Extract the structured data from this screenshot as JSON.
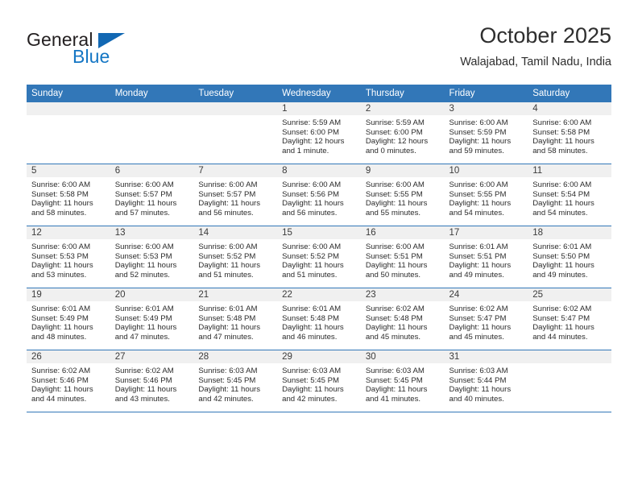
{
  "brand": {
    "name_top": "General",
    "name_bottom": "Blue",
    "triangle_icon": "triangle-icon",
    "accent_color": "#1476c4",
    "triangle_color": "#1268b3"
  },
  "header": {
    "title": "October 2025",
    "subtitle": "Walajabad, Tamil Nadu, India"
  },
  "calendar": {
    "header_bg": "#3277b8",
    "header_text_color": "#ffffff",
    "daynum_bg": "#f0f0f0",
    "row_separator_color": "#3277b8",
    "weekdays": [
      "Sunday",
      "Monday",
      "Tuesday",
      "Wednesday",
      "Thursday",
      "Friday",
      "Saturday"
    ],
    "weeks": [
      [
        {
          "day": "",
          "empty": true
        },
        {
          "day": "",
          "empty": true
        },
        {
          "day": "",
          "empty": true
        },
        {
          "day": "1",
          "sunrise": "Sunrise: 5:59 AM",
          "sunset": "Sunset: 6:00 PM",
          "daylight": "Daylight: 12 hours and 1 minute."
        },
        {
          "day": "2",
          "sunrise": "Sunrise: 5:59 AM",
          "sunset": "Sunset: 6:00 PM",
          "daylight": "Daylight: 12 hours and 0 minutes."
        },
        {
          "day": "3",
          "sunrise": "Sunrise: 6:00 AM",
          "sunset": "Sunset: 5:59 PM",
          "daylight": "Daylight: 11 hours and 59 minutes."
        },
        {
          "day": "4",
          "sunrise": "Sunrise: 6:00 AM",
          "sunset": "Sunset: 5:58 PM",
          "daylight": "Daylight: 11 hours and 58 minutes."
        }
      ],
      [
        {
          "day": "5",
          "sunrise": "Sunrise: 6:00 AM",
          "sunset": "Sunset: 5:58 PM",
          "daylight": "Daylight: 11 hours and 58 minutes."
        },
        {
          "day": "6",
          "sunrise": "Sunrise: 6:00 AM",
          "sunset": "Sunset: 5:57 PM",
          "daylight": "Daylight: 11 hours and 57 minutes."
        },
        {
          "day": "7",
          "sunrise": "Sunrise: 6:00 AM",
          "sunset": "Sunset: 5:57 PM",
          "daylight": "Daylight: 11 hours and 56 minutes."
        },
        {
          "day": "8",
          "sunrise": "Sunrise: 6:00 AM",
          "sunset": "Sunset: 5:56 PM",
          "daylight": "Daylight: 11 hours and 56 minutes."
        },
        {
          "day": "9",
          "sunrise": "Sunrise: 6:00 AM",
          "sunset": "Sunset: 5:55 PM",
          "daylight": "Daylight: 11 hours and 55 minutes."
        },
        {
          "day": "10",
          "sunrise": "Sunrise: 6:00 AM",
          "sunset": "Sunset: 5:55 PM",
          "daylight": "Daylight: 11 hours and 54 minutes."
        },
        {
          "day": "11",
          "sunrise": "Sunrise: 6:00 AM",
          "sunset": "Sunset: 5:54 PM",
          "daylight": "Daylight: 11 hours and 54 minutes."
        }
      ],
      [
        {
          "day": "12",
          "sunrise": "Sunrise: 6:00 AM",
          "sunset": "Sunset: 5:53 PM",
          "daylight": "Daylight: 11 hours and 53 minutes."
        },
        {
          "day": "13",
          "sunrise": "Sunrise: 6:00 AM",
          "sunset": "Sunset: 5:53 PM",
          "daylight": "Daylight: 11 hours and 52 minutes."
        },
        {
          "day": "14",
          "sunrise": "Sunrise: 6:00 AM",
          "sunset": "Sunset: 5:52 PM",
          "daylight": "Daylight: 11 hours and 51 minutes."
        },
        {
          "day": "15",
          "sunrise": "Sunrise: 6:00 AM",
          "sunset": "Sunset: 5:52 PM",
          "daylight": "Daylight: 11 hours and 51 minutes."
        },
        {
          "day": "16",
          "sunrise": "Sunrise: 6:00 AM",
          "sunset": "Sunset: 5:51 PM",
          "daylight": "Daylight: 11 hours and 50 minutes."
        },
        {
          "day": "17",
          "sunrise": "Sunrise: 6:01 AM",
          "sunset": "Sunset: 5:51 PM",
          "daylight": "Daylight: 11 hours and 49 minutes."
        },
        {
          "day": "18",
          "sunrise": "Sunrise: 6:01 AM",
          "sunset": "Sunset: 5:50 PM",
          "daylight": "Daylight: 11 hours and 49 minutes."
        }
      ],
      [
        {
          "day": "19",
          "sunrise": "Sunrise: 6:01 AM",
          "sunset": "Sunset: 5:49 PM",
          "daylight": "Daylight: 11 hours and 48 minutes."
        },
        {
          "day": "20",
          "sunrise": "Sunrise: 6:01 AM",
          "sunset": "Sunset: 5:49 PM",
          "daylight": "Daylight: 11 hours and 47 minutes."
        },
        {
          "day": "21",
          "sunrise": "Sunrise: 6:01 AM",
          "sunset": "Sunset: 5:48 PM",
          "daylight": "Daylight: 11 hours and 47 minutes."
        },
        {
          "day": "22",
          "sunrise": "Sunrise: 6:01 AM",
          "sunset": "Sunset: 5:48 PM",
          "daylight": "Daylight: 11 hours and 46 minutes."
        },
        {
          "day": "23",
          "sunrise": "Sunrise: 6:02 AM",
          "sunset": "Sunset: 5:48 PM",
          "daylight": "Daylight: 11 hours and 45 minutes."
        },
        {
          "day": "24",
          "sunrise": "Sunrise: 6:02 AM",
          "sunset": "Sunset: 5:47 PM",
          "daylight": "Daylight: 11 hours and 45 minutes."
        },
        {
          "day": "25",
          "sunrise": "Sunrise: 6:02 AM",
          "sunset": "Sunset: 5:47 PM",
          "daylight": "Daylight: 11 hours and 44 minutes."
        }
      ],
      [
        {
          "day": "26",
          "sunrise": "Sunrise: 6:02 AM",
          "sunset": "Sunset: 5:46 PM",
          "daylight": "Daylight: 11 hours and 44 minutes."
        },
        {
          "day": "27",
          "sunrise": "Sunrise: 6:02 AM",
          "sunset": "Sunset: 5:46 PM",
          "daylight": "Daylight: 11 hours and 43 minutes."
        },
        {
          "day": "28",
          "sunrise": "Sunrise: 6:03 AM",
          "sunset": "Sunset: 5:45 PM",
          "daylight": "Daylight: 11 hours and 42 minutes."
        },
        {
          "day": "29",
          "sunrise": "Sunrise: 6:03 AM",
          "sunset": "Sunset: 5:45 PM",
          "daylight": "Daylight: 11 hours and 42 minutes."
        },
        {
          "day": "30",
          "sunrise": "Sunrise: 6:03 AM",
          "sunset": "Sunset: 5:45 PM",
          "daylight": "Daylight: 11 hours and 41 minutes."
        },
        {
          "day": "31",
          "sunrise": "Sunrise: 6:03 AM",
          "sunset": "Sunset: 5:44 PM",
          "daylight": "Daylight: 11 hours and 40 minutes."
        },
        {
          "day": "",
          "empty": true
        }
      ]
    ]
  }
}
